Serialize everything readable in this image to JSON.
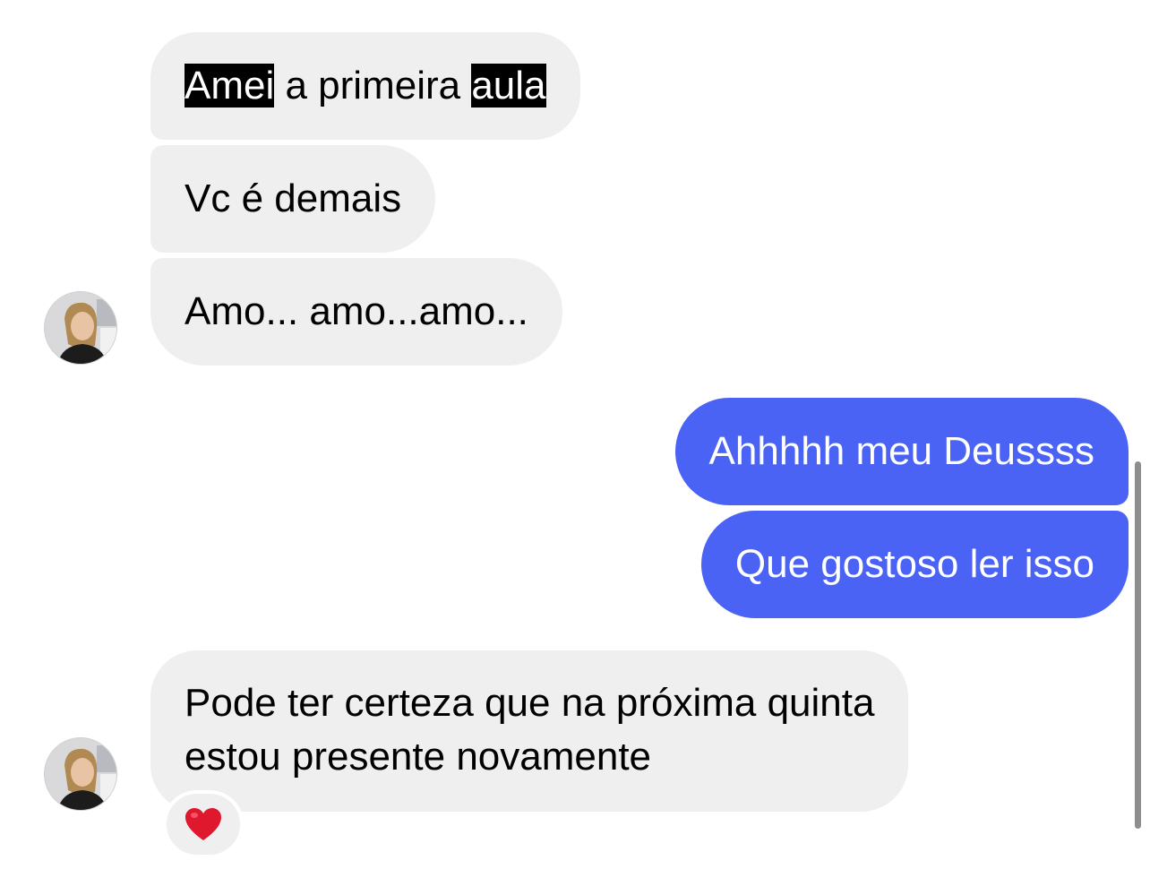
{
  "messages": {
    "m1": {
      "word1": "Amei",
      "middle": " a primeira ",
      "word2": "aula"
    },
    "m2": {
      "text": "Vc é demais"
    },
    "m3": {
      "text": "Amo... amo...amo..."
    },
    "m4": {
      "text": "Ahhhhh meu Deussss"
    },
    "m5": {
      "text": "Que gostoso ler isso"
    },
    "m6": {
      "line1": "Pode ter certeza que na próxima quinta",
      "line2": "estou presente novamente"
    }
  },
  "reaction": {
    "icon": "heart-icon",
    "color": "#e0182e"
  },
  "colors": {
    "incoming_bubble": "#efefef",
    "outgoing_bubble": "#4b63f5",
    "highlight": "#000000"
  }
}
